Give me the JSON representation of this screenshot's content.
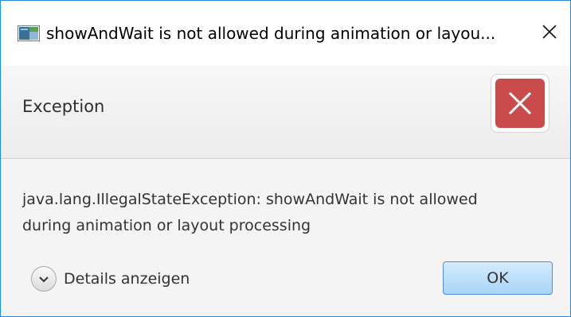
{
  "window": {
    "title": "showAndWait is not allowed during animation or layou...",
    "app_icon": "java-app-icon",
    "close_icon": "close-icon"
  },
  "header": {
    "title": "Exception",
    "icon": "error-x-icon",
    "icon_color": "#c94b4b"
  },
  "content": {
    "message_line1": "java.lang.IllegalStateException: showAndWait is not allowed",
    "message_line2": "during animation or layout processing"
  },
  "footer": {
    "details_label": "Details anzeigen",
    "details_icon": "chevron-down-icon",
    "ok_label": "OK"
  },
  "colors": {
    "window_border": "#2b8ad6",
    "ok_button_bg": "#a9d4f5",
    "ok_button_border": "#4f8fcf"
  }
}
